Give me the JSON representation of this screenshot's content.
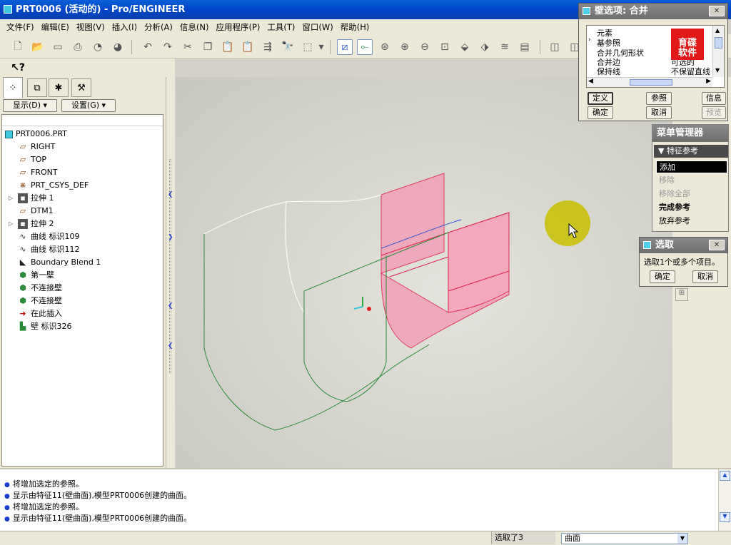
{
  "window": {
    "title": "PRT0006 (活动的) - Pro/ENGINEER"
  },
  "menubar": [
    "文件(F)",
    "编辑(E)",
    "视图(V)",
    "插入(I)",
    "分析(A)",
    "信息(N)",
    "应用程序(P)",
    "工具(T)",
    "窗口(W)",
    "帮助(H)"
  ],
  "left_panel": {
    "show_button": "显示(D) ▾",
    "settings_button": "设置(G) ▾",
    "tree": [
      {
        "label": "PRT0006.PRT",
        "icon": "part-icon"
      },
      {
        "label": "RIGHT",
        "icon": "datum-plane-icon"
      },
      {
        "label": "TOP",
        "icon": "datum-plane-icon"
      },
      {
        "label": "FRONT",
        "icon": "datum-plane-icon"
      },
      {
        "label": "PRT_CSYS_DEF",
        "icon": "csys-icon"
      },
      {
        "label": "拉伸 1",
        "icon": "extrude-icon"
      },
      {
        "label": "DTM1",
        "icon": "datum-plane-icon"
      },
      {
        "label": "拉伸 2",
        "icon": "extrude-icon"
      },
      {
        "label": "曲线 标识109",
        "icon": "curve-icon"
      },
      {
        "label": "曲线 标识112",
        "icon": "curve-icon"
      },
      {
        "label": "Boundary Blend 1",
        "icon": "blend-icon"
      },
      {
        "label": "第一壁",
        "icon": "wall-icon"
      },
      {
        "label": "不连接壁",
        "icon": "wall-icon"
      },
      {
        "label": "不连接壁",
        "icon": "wall-icon"
      },
      {
        "label": "在此插入",
        "icon": "insert-arrow-icon"
      },
      {
        "label": "壁 标识326",
        "icon": "wall-new-icon"
      }
    ]
  },
  "messages": [
    "将增加选定的参照。",
    "显示由特征11(壁曲面),模型PRT0006创建的曲面。",
    "将增加选定的参照。",
    "显示由特征11(壁曲面),模型PRT0006创建的曲面。"
  ],
  "status": {
    "selected": "选取了3",
    "filter": "曲面"
  },
  "wall_dialog": {
    "title": "壁选项: 合并",
    "rows": [
      {
        "name": "元素",
        "value": ""
      },
      {
        "name": "基参照",
        "value": ""
      },
      {
        "name": "合并几何形状",
        "value": ""
      },
      {
        "name": "合并边",
        "value": "可选的"
      },
      {
        "name": "保持线",
        "value": "不保留直线"
      }
    ],
    "watermark": "育碟\n软件",
    "buttons": {
      "define": "定义",
      "refs": "参照",
      "info": "信息",
      "ok": "确定",
      "cancel": "取消",
      "preview": "预览"
    }
  },
  "menu_manager": {
    "title": "菜单管理器",
    "group": "特征参考",
    "items": [
      {
        "label": "添加",
        "state": "selected"
      },
      {
        "label": "移除",
        "state": "disabled"
      },
      {
        "label": "移除全部",
        "state": "disabled"
      },
      {
        "label": "完成参考",
        "state": "bold"
      },
      {
        "label": "放弃参考",
        "state": "normal"
      }
    ]
  },
  "select_dialog": {
    "title": "选取",
    "prompt": "选取1个或多个项目。",
    "ok": "确定",
    "cancel": "取消"
  },
  "colors": {
    "titlebar": "#0046c8",
    "highlight_surface": "#f2a0b8",
    "edge_green": "#2a8a3a",
    "edge_red": "#e0204a",
    "cursor_halo": "#c8c000"
  }
}
